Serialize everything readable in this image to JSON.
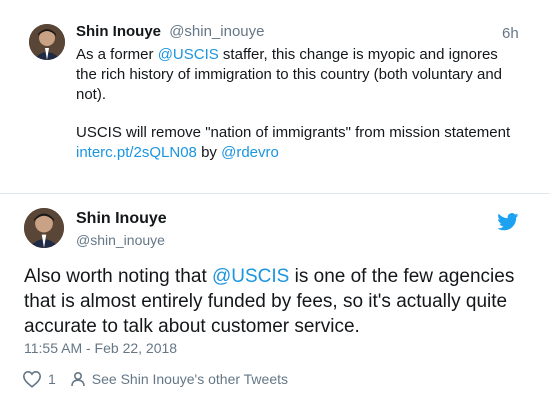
{
  "colors": {
    "link": "#1b95e0",
    "text": "#14171a",
    "muted": "#657786",
    "twitter_blue": "#1da1f2"
  },
  "tweet1": {
    "name": "Shin Inouye",
    "handle": "@shin_inouye",
    "time": "6h",
    "text_line1_pre": "As a former ",
    "text_line1_mention": "@USCIS",
    "text_line1_post": " staffer, this change is myopic and ignores",
    "text_line2": "the rich history of immigration to this country (both voluntary and",
    "text_line3": "not).",
    "quote_title": "USCIS will remove \"nation of immigrants\" from mission statement",
    "quote_link": "interc.pt/2sQLN08",
    "quote_by": " by ",
    "quote_mention": "@rdevro"
  },
  "tweet2": {
    "name": "Shin Inouye",
    "handle": "@shin_inouye",
    "text_pre": "Also worth noting that ",
    "text_mention": "@USCIS",
    "text_post": " is one of the few agencies that is almost entirely funded by fees, so it's actually quite accurate to talk about customer service.",
    "timestamp": "11:55 AM - Feb 22, 2018",
    "like_count": "1",
    "other_tweets_label": "See Shin Inouye's other Tweets"
  },
  "icons": {
    "avatar": "avatar-photo",
    "bird": "twitter-bird-icon",
    "heart": "heart-icon",
    "person": "person-icon"
  }
}
